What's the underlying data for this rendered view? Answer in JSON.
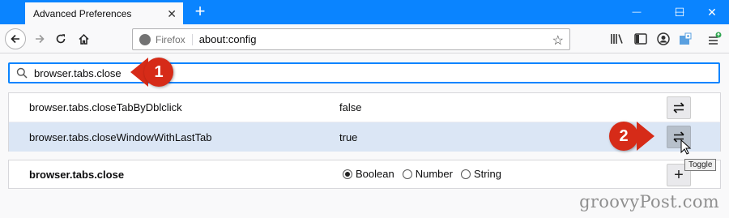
{
  "window": {
    "tab_title": "Advanced Preferences",
    "tab_close_glyph": "✕",
    "new_tab_glyph": "+",
    "minimize_glyph": "—",
    "maximize_glyph": "☐",
    "close_glyph": "✕",
    "accent_color": "#0a84ff"
  },
  "toolbar": {
    "identity_label": "Firefox",
    "url": "about:config",
    "icons": [
      "back-icon",
      "forward-icon",
      "reload-icon",
      "home-icon",
      "bookmark-star-icon",
      "library-icon",
      "sidebar-icon",
      "account-icon",
      "extension-icon",
      "menu-icon"
    ]
  },
  "search": {
    "value": "browser.tabs.close"
  },
  "callouts": {
    "one": "1",
    "two": "2",
    "color": "#d62b18"
  },
  "prefs": [
    {
      "name": "browser.tabs.closeTabByDblclick",
      "value": "false",
      "action": "toggle"
    },
    {
      "name": "browser.tabs.closeWindowWithLastTab",
      "value": "true",
      "action": "toggle",
      "highlighted": true
    }
  ],
  "tooltip": "Toggle",
  "new_pref": {
    "name": "browser.tabs.close",
    "types": [
      {
        "label": "Boolean",
        "checked": true
      },
      {
        "label": "Number",
        "checked": false
      },
      {
        "label": "String",
        "checked": false
      }
    ],
    "add_glyph": "+"
  },
  "watermark": "groovyPost.com"
}
